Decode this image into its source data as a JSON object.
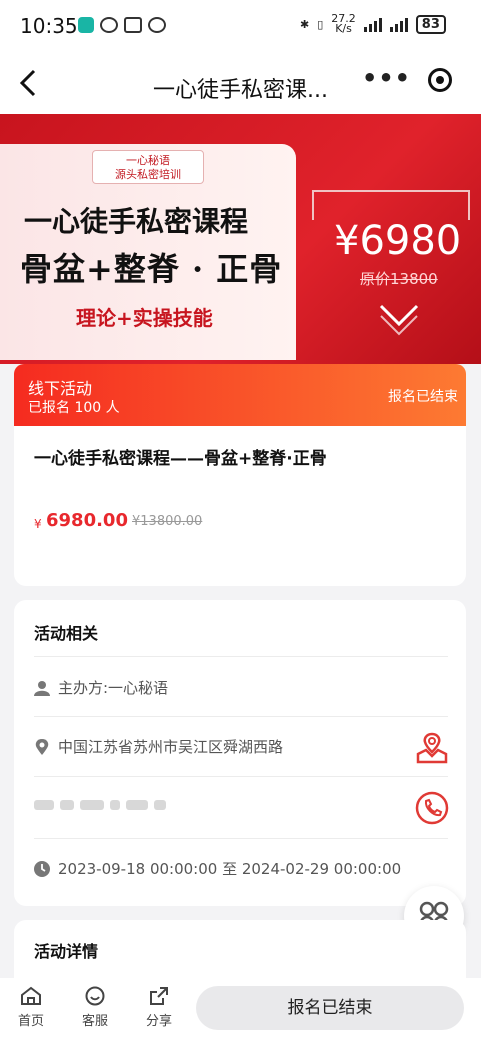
{
  "status_bar": {
    "time": "10:35",
    "net_speed": "27.2",
    "net_unit": "K/s",
    "battery": "83"
  },
  "nav": {
    "title": "一心徒手私密课...",
    "menu_dots": "•••"
  },
  "banner": {
    "tag_line1": "一心秘语",
    "tag_line2": "源头私密培训",
    "title_line1": "一心徒手私密课程",
    "title_line2": "骨盆+整脊 · 正骨",
    "subtitle": "理论+实操技能",
    "price": "¥6980",
    "original_price": "原价13800"
  },
  "activity": {
    "type": "线下活动",
    "signup_count": "已报名 100 人",
    "status": "报名已结束"
  },
  "info": {
    "title": "一心徒手私密课程——骨盆+整脊·正骨",
    "currency": "¥",
    "price": "6980.00",
    "original_price": "¥13800.00"
  },
  "related": {
    "heading": "活动相关",
    "organizer": "主办方:一心秘语",
    "address": "中国江苏省苏州市吴江区舜湖西路",
    "time_range": "2023-09-18 00:00:00 至 2024-02-29 00:00:00"
  },
  "details": {
    "heading": "活动详情"
  },
  "bottom_bar": {
    "home": "首页",
    "service": "客服",
    "share": "分享",
    "signup_button": "报名已结束"
  },
  "colors": {
    "accent": "#e8282d",
    "banner_red": "#d01a22",
    "gradient_start": "#f52b20",
    "gradient_end": "#fd7a32"
  }
}
